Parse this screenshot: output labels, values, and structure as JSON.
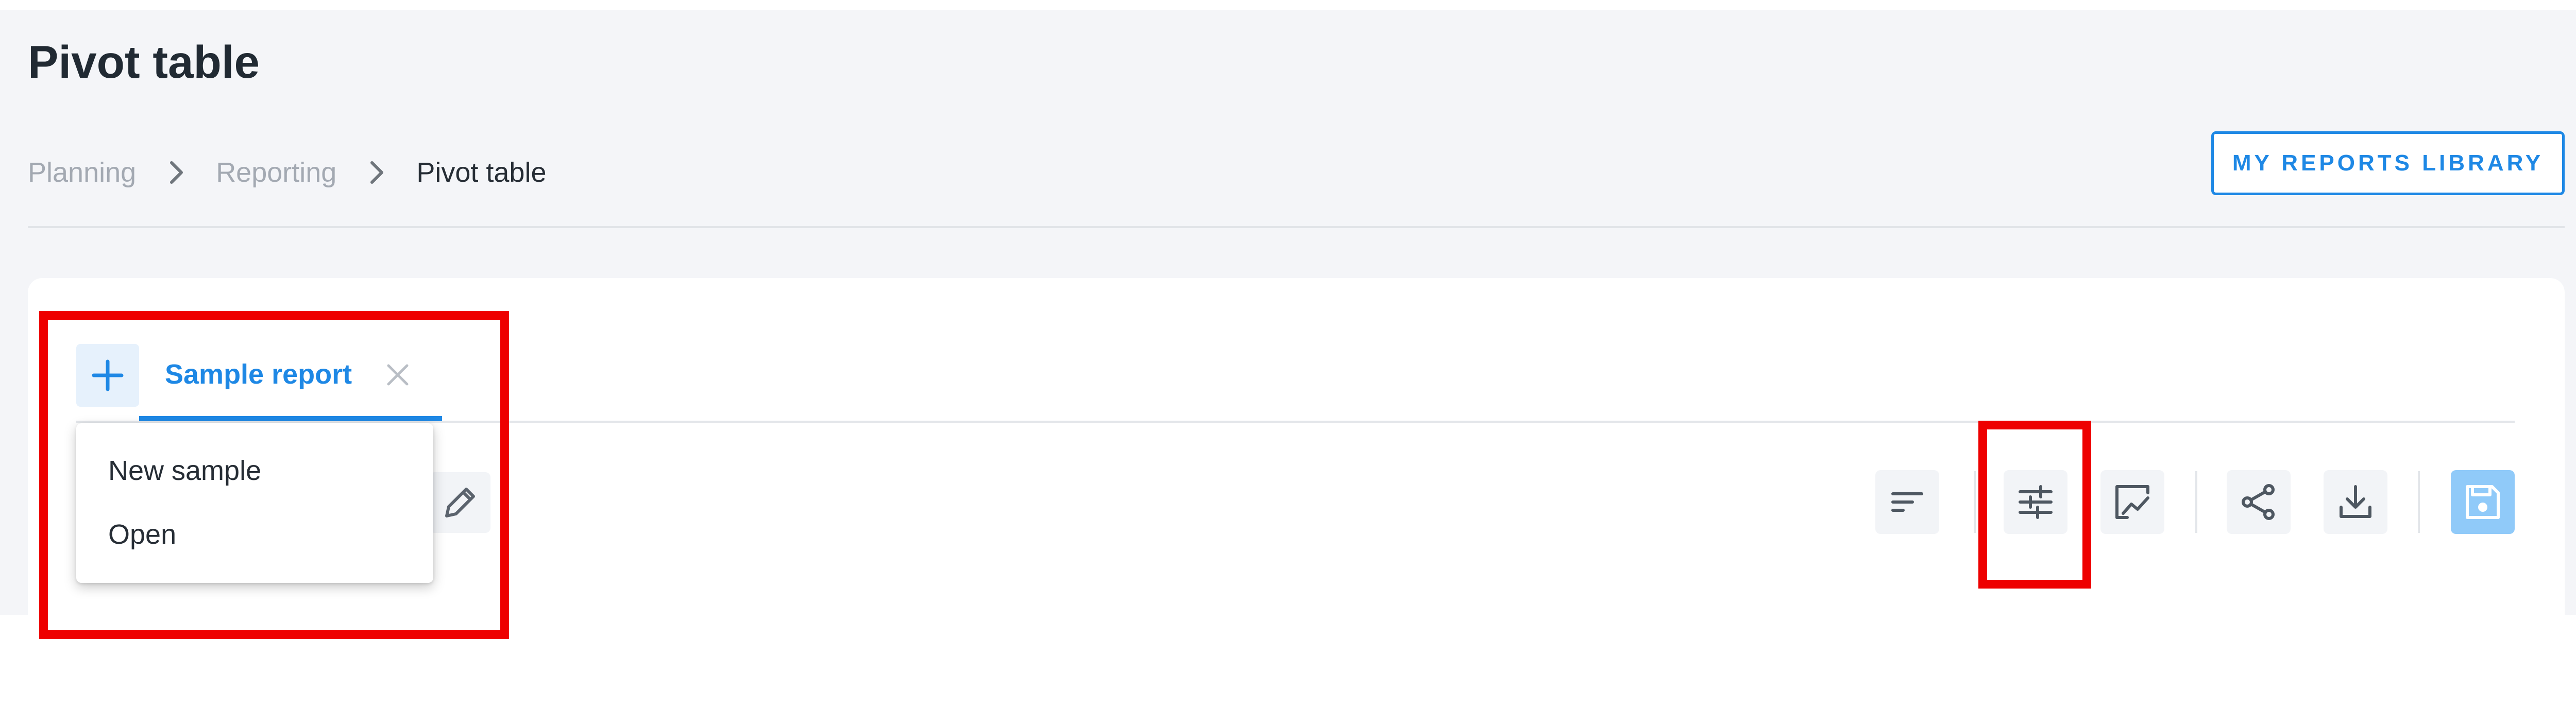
{
  "page": {
    "title": "Pivot table"
  },
  "breadcrumb": {
    "items": [
      "Planning",
      "Reporting",
      "Pivot table"
    ]
  },
  "header": {
    "library_button_label": "MY REPORTS LIBRARY"
  },
  "tabs": {
    "add_icon": "plus-icon",
    "active_tab_label": "Sample report",
    "close_icon": "close-icon"
  },
  "dropdown": {
    "items": [
      "New sample",
      "Open"
    ]
  },
  "toolbar": {
    "buttons": [
      {
        "icon": "sort-icon"
      },
      {
        "icon": "settings-sliders-icon"
      },
      {
        "icon": "chart-icon"
      },
      {
        "icon": "share-icon"
      },
      {
        "icon": "download-icon"
      },
      {
        "icon": "save-icon"
      }
    ],
    "edit_icon": "pencil-icon"
  },
  "colors": {
    "accent": "#1e88e5",
    "annotation": "#ee0000",
    "save_button_bg": "#90caf9",
    "background": "#f4f5f8"
  }
}
